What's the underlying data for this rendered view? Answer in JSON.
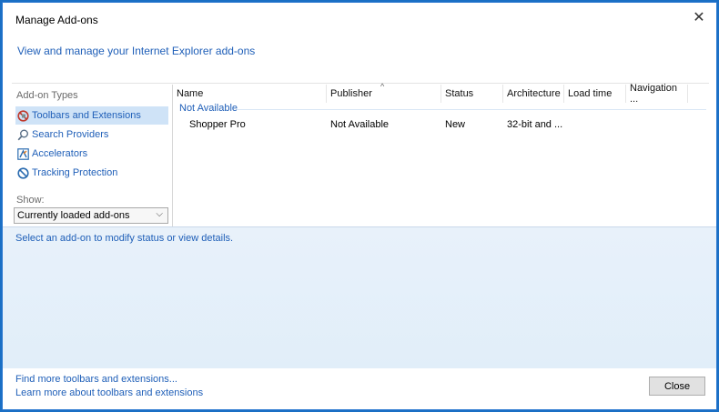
{
  "window": {
    "title": "Manage Add-ons",
    "header_link": "View and manage your Internet Explorer add-ons"
  },
  "sidebar": {
    "types_label": "Add-on Types",
    "items": [
      {
        "label": "Toolbars and Extensions",
        "icon": "toolbars-extensions-icon",
        "selected": true
      },
      {
        "label": "Search Providers",
        "icon": "search-icon",
        "selected": false
      },
      {
        "label": "Accelerators",
        "icon": "accelerators-icon",
        "selected": false
      },
      {
        "label": "Tracking Protection",
        "icon": "tracking-protection-icon",
        "selected": false
      }
    ],
    "show_label": "Show:",
    "show_value": "Currently loaded add-ons"
  },
  "list": {
    "columns": [
      "Name",
      "Publisher",
      "Status",
      "Architecture",
      "Load time",
      "Navigation ..."
    ],
    "group": "Not Available",
    "rows": [
      {
        "name": "Shopper Pro",
        "publisher": "Not Available",
        "status": "New",
        "architecture": "32-bit and ...",
        "load_time": "",
        "navigation": ""
      }
    ]
  },
  "details": {
    "prompt": "Select an add-on to modify status or view details."
  },
  "footer": {
    "link1": "Find more toolbars and extensions...",
    "link2": "Learn more about toolbars and extensions",
    "close_label": "Close"
  },
  "colors": {
    "accent": "#1f5fb8",
    "frame": "#1a6fc4",
    "selection": "#cfe3f7"
  }
}
